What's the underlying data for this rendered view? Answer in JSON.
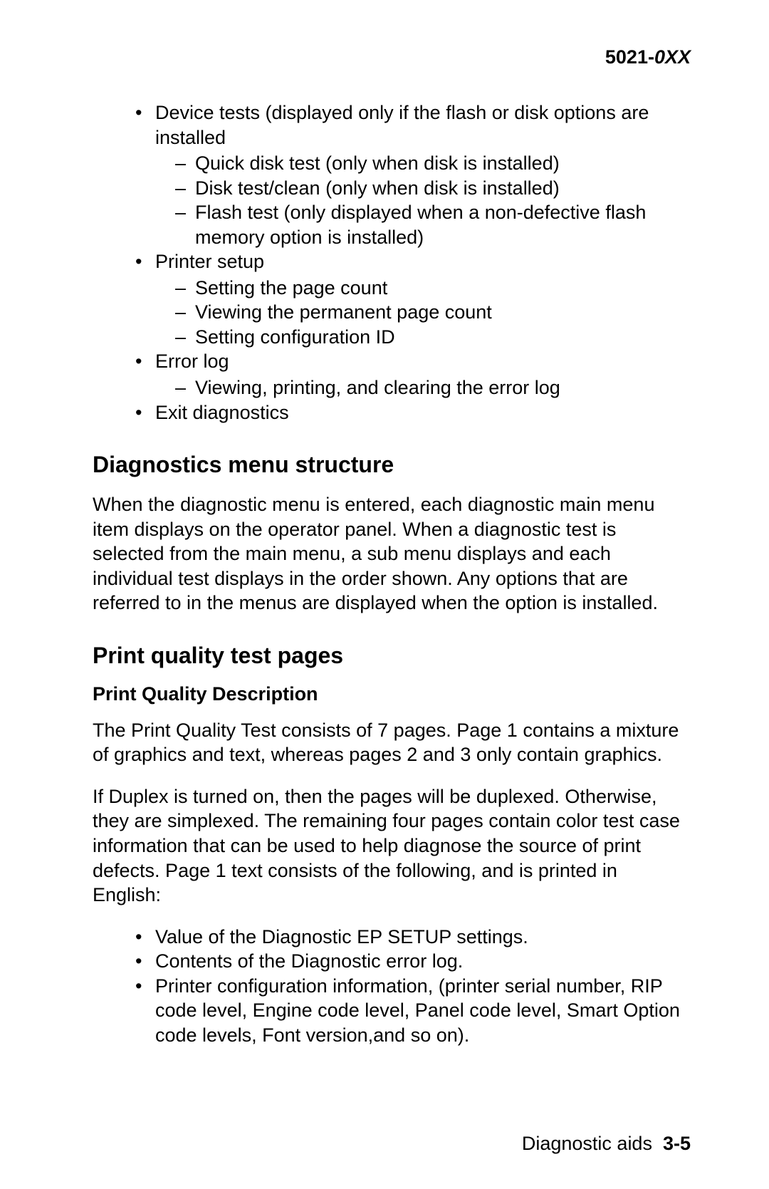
{
  "header": {
    "model_prefix": "5021-",
    "model_suffix": "0XX"
  },
  "top_list": [
    {
      "text": "Device tests (displayed only if the flash or disk options are installed",
      "sub": [
        "Quick disk test (only when disk is installed)",
        "Disk test/clean (only when disk is installed)",
        "Flash test (only displayed when a non-defective flash memory option is installed)"
      ]
    },
    {
      "text": "Printer setup",
      "sub": [
        "Setting the page count",
        "Viewing the permanent page count",
        "Setting configuration ID"
      ]
    },
    {
      "text": "Error log",
      "sub": [
        "Viewing, printing, and clearing the error log"
      ]
    },
    {
      "text": "Exit diagnostics",
      "sub": []
    }
  ],
  "section1": {
    "title": "Diagnostics menu structure",
    "para": "When the diagnostic menu is entered, each diagnostic main menu item displays on the operator panel. When a diagnostic test is selected from the main menu, a sub menu displays and each individual test displays in the order shown. Any options that are referred to in the menus are displayed when the option is installed."
  },
  "section2": {
    "title": "Print quality test pages",
    "subtitle": "Print Quality Description",
    "para1": "The Print Quality Test consists of 7 pages. Page 1 contains a mixture of graphics and text, whereas pages 2 and 3 only contain graphics.",
    "para2": "If Duplex is turned on, then the pages will be duplexed. Otherwise, they are simplexed. The remaining four pages contain color test case information that can be used to help diagnose the source of print defects. Page 1 text consists of the following, and is printed in English:",
    "bullets": [
      "Value of the Diagnostic EP SETUP settings.",
      "Contents of the Diagnostic error log.",
      "Printer configuration information, (printer serial number, RIP code level, Engine code level, Panel code level, Smart Option code levels, Font version,and so on)."
    ]
  },
  "footer": {
    "label": "Diagnostic aids",
    "page": "3-5"
  }
}
